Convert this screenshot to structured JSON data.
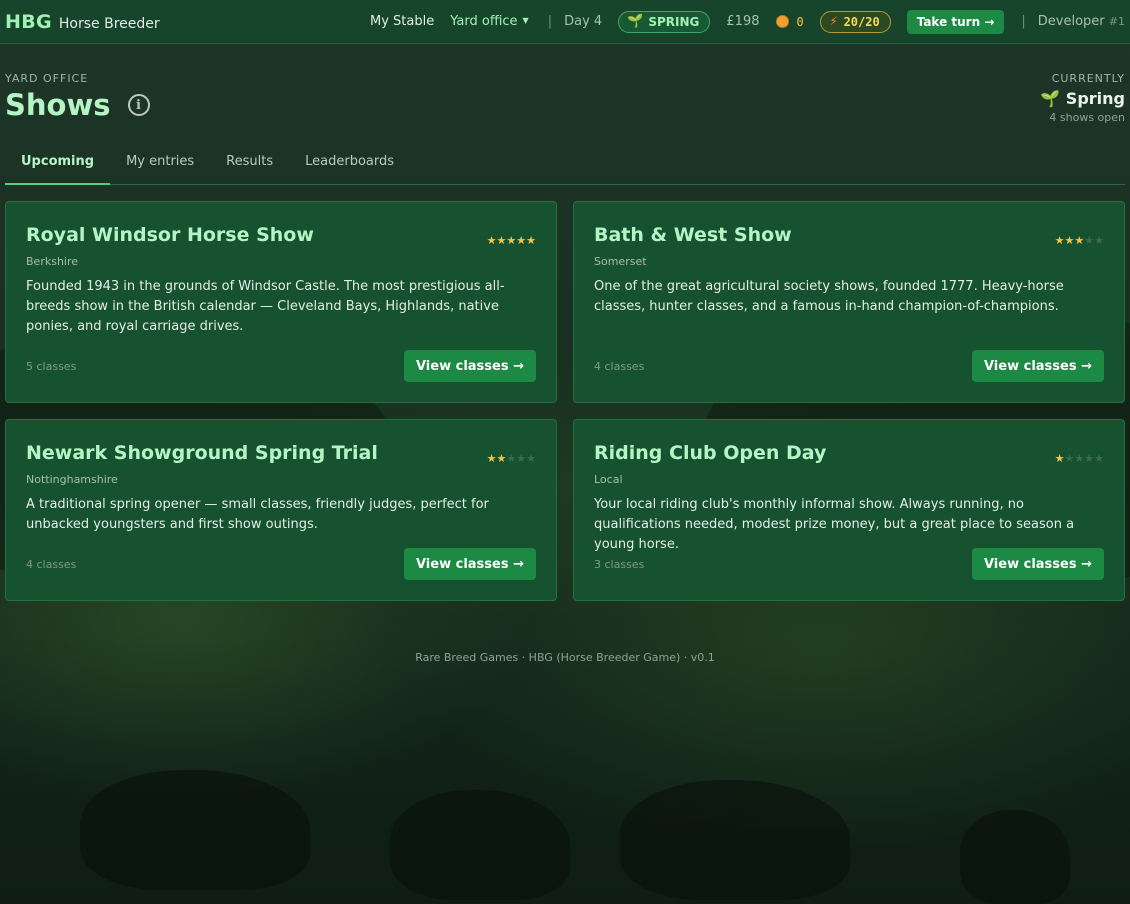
{
  "topbar": {
    "brand_mark": "HBG",
    "brand_name": "Horse Breeder",
    "nav": {
      "my_stable": "My Stable",
      "yard_office": "Yard office"
    },
    "separator": "|",
    "day": "Day 4",
    "season": "SPRING",
    "money": "£198",
    "coins": "0",
    "energy": "20/20",
    "take_turn": "Take turn →",
    "user_name": "Developer",
    "user_num": "#1"
  },
  "header": {
    "eyebrow": "YARD OFFICE",
    "title": "Shows",
    "currently_label": "CURRENTLY",
    "currently_season": "Spring",
    "currently_sub": "4 shows open"
  },
  "tabs": [
    {
      "label": "Upcoming",
      "active": true
    },
    {
      "label": "My entries",
      "active": false
    },
    {
      "label": "Results",
      "active": false
    },
    {
      "label": "Leaderboards",
      "active": false
    }
  ],
  "shows": [
    {
      "title": "Royal Windsor Horse Show",
      "region": "Berkshire",
      "stars": 5,
      "description": "Founded 1943 in the grounds of Windsor Castle. The most prestigious all-breeds show in the British calendar — Cleveland Bays, Highlands, native ponies, and royal carriage drives.",
      "classes": "5 classes",
      "button": "View classes →"
    },
    {
      "title": "Bath & West Show",
      "region": "Somerset",
      "stars": 3,
      "description": "One of the great agricultural society shows, founded 1777. Heavy-horse classes, hunter classes, and a famous in-hand champion-of-champions.",
      "classes": "4 classes",
      "button": "View classes →"
    },
    {
      "title": "Newark Showground Spring Trial",
      "region": "Nottinghamshire",
      "stars": 2,
      "description": "A traditional spring opener — small classes, friendly judges, perfect for unbacked youngsters and first show outings.",
      "classes": "4 classes",
      "button": "View classes →"
    },
    {
      "title": "Riding Club Open Day",
      "region": "Local",
      "stars": 1,
      "description": "Your local riding club's monthly informal show. Always running, no qualifications needed, modest prize money, but a great place to season a young horse.",
      "classes": "3 classes",
      "button": "View classes →"
    }
  ],
  "footer": "Rare Breed Games · HBG (Horse Breeder Game) · v0.1",
  "icons": {
    "season": "sprout-icon",
    "coin": "coin-icon",
    "energy": "lightning-icon",
    "info": "info-icon",
    "caret": "chevron-down-icon"
  },
  "colors": {
    "accent": "#9ff2b4",
    "button": "#1c8a45",
    "card": "#175230",
    "star": "#f5c542"
  }
}
